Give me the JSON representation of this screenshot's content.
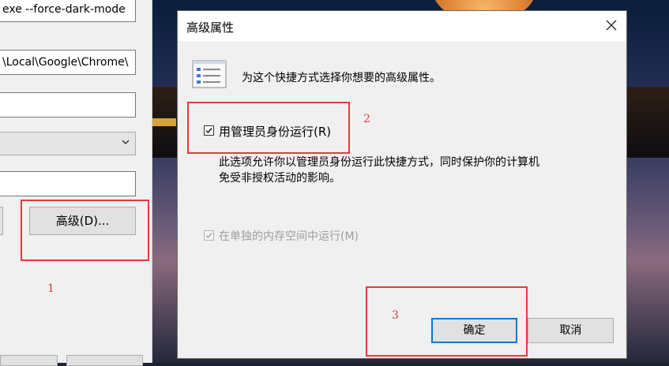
{
  "background_window": {
    "target_value": "exe --force-dark-mode",
    "start_in_value": "\\Local\\Google\\Chrome\\",
    "advanced_button_label": "高级(D)..."
  },
  "dialog": {
    "title": "高级属性",
    "close_icon": "close-icon",
    "description": "为这个快捷方式选择你想要的高级属性。",
    "run_as_admin": {
      "label": "用管理员身份运行(R)",
      "checked": true
    },
    "info_lines": [
      "此选项允许你以管理员身份运行此快捷方式，同时保护你的计算机",
      "免受非授权活动的影响。"
    ],
    "separate_memory": {
      "label": "在单独的内存空间中运行(M)",
      "checked": true,
      "disabled": true
    },
    "ok_label": "确定",
    "cancel_label": "取消"
  },
  "annotations": {
    "step1": "1",
    "step2": "2",
    "step3": "3",
    "color": "#e43b3b"
  }
}
